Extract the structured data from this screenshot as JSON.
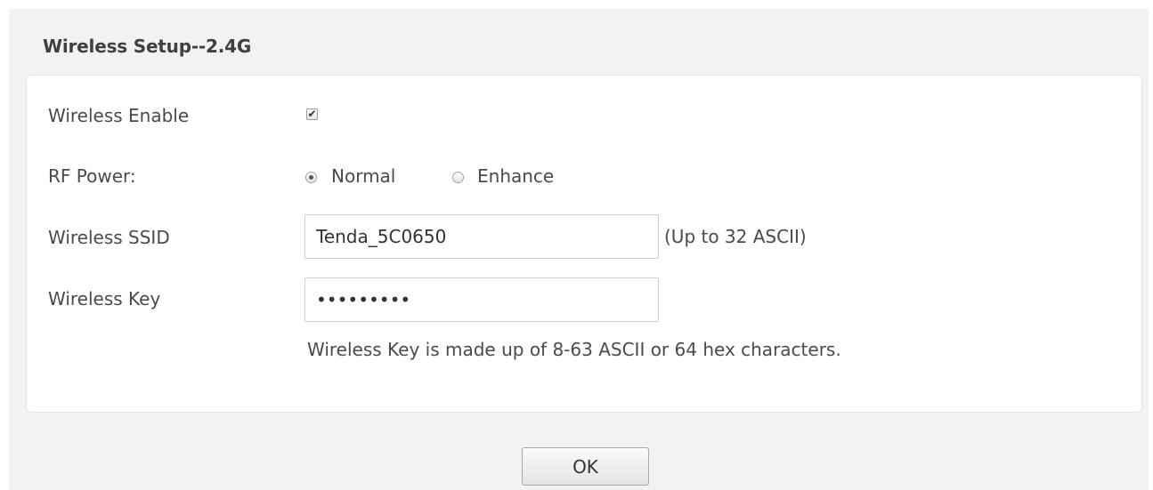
{
  "section": {
    "title": "Wireless Setup--2.4G"
  },
  "form": {
    "wireless_enable": {
      "label": "Wireless Enable",
      "checked": true,
      "check_glyph": "✔"
    },
    "rf_power": {
      "label": "RF Power:",
      "options": [
        {
          "label": "Normal",
          "selected": true
        },
        {
          "label": "Enhance",
          "selected": false
        }
      ]
    },
    "ssid": {
      "label": "Wireless SSID",
      "value": "Tenda_5C0650",
      "hint": "(Up to 32 ASCII)"
    },
    "key": {
      "label": "Wireless Key",
      "value": "•••••••••",
      "hint": "Wireless Key is made up of 8-63 ASCII or 64 hex characters."
    }
  },
  "actions": {
    "ok_label": "OK"
  }
}
